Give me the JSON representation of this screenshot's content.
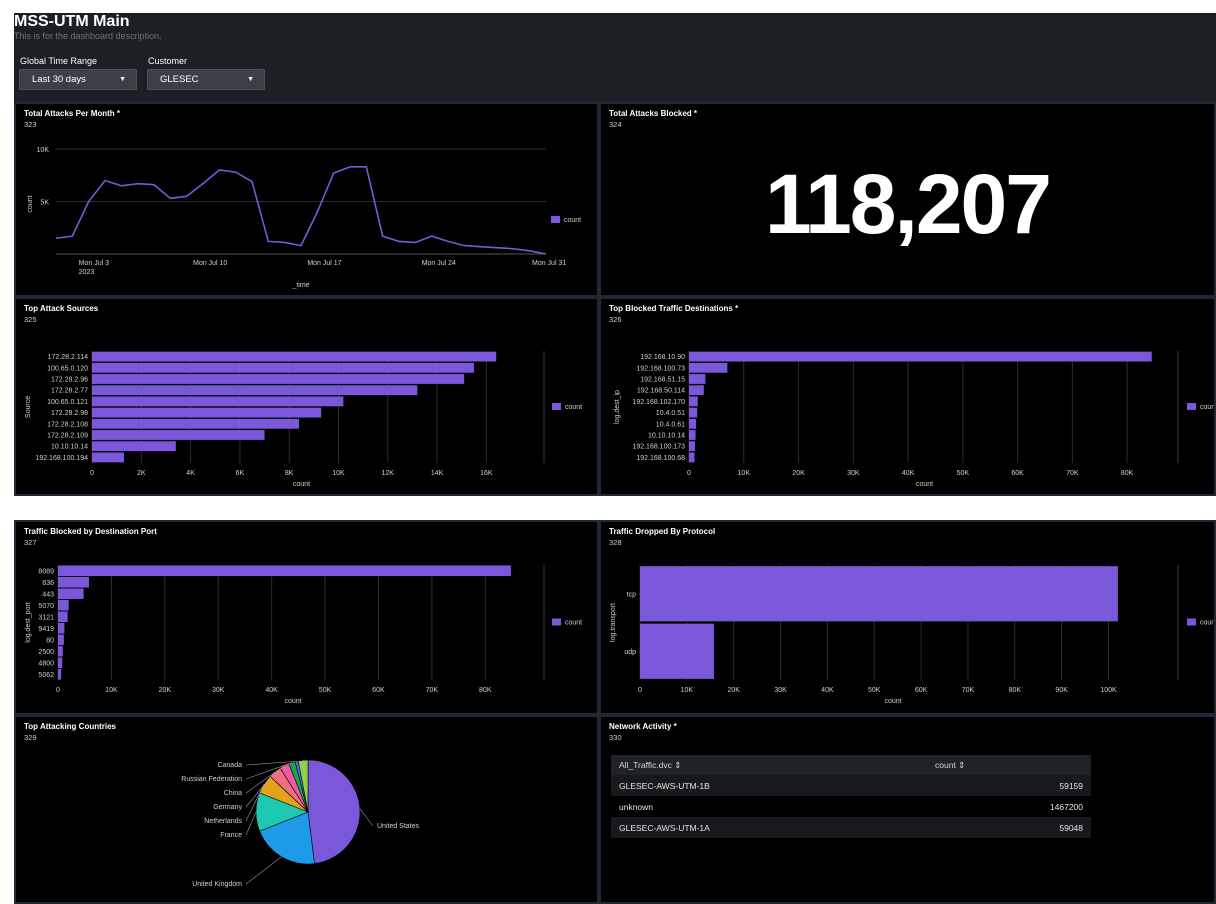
{
  "dashboard": {
    "title": "MSS-UTM Main",
    "description": "This is for the dashboard description.",
    "filters": [
      {
        "label": "Global Time Range",
        "value": "Last 30 days"
      },
      {
        "label": "Customer",
        "value": "GLESEC"
      }
    ]
  },
  "panels": {
    "attacks_month": {
      "title": "Total Attacks Per Month *",
      "id": "323"
    },
    "attacks_blocked": {
      "title": "Total Attacks Blocked *",
      "id": "324",
      "value": "118,207"
    },
    "attack_sources": {
      "title": "Top Attack Sources",
      "id": "325"
    },
    "blocked_dest": {
      "title": "Top Blocked Traffic Destinations *",
      "id": "326"
    },
    "dest_port": {
      "title": "Traffic Blocked by Destination Port",
      "id": "327"
    },
    "protocol": {
      "title": "Traffic Dropped By Protocol",
      "id": "328"
    },
    "countries": {
      "title": "Top Attacking Countries",
      "id": "329"
    },
    "network": {
      "title": "Network Activity *",
      "id": "330",
      "columns": [
        "All_Traffic.dvc ⇕",
        "count ⇕"
      ],
      "rows": [
        [
          "GLESEC-AWS-UTM-1B",
          "59159"
        ],
        [
          "unknown",
          "1467200"
        ],
        [
          "GLESEC-AWS-UTM-1A",
          "59048"
        ]
      ]
    }
  },
  "colors": {
    "series": "#7b57d9",
    "background": "#000000",
    "header": "#1c1f24"
  },
  "chart_data": [
    {
      "type": "line",
      "panel": "attacks_month",
      "xlabel": "_time",
      "ylabel": "count",
      "x_ticks": [
        "Mon Jul 3\n2023",
        "Mon Jul 10",
        "Mon Jul 17",
        "Mon Jul 24",
        "Mon Jul 31"
      ],
      "y_ticks": [
        "5K",
        "10K"
      ],
      "ylim": [
        0,
        10000
      ],
      "series": [
        {
          "name": "count",
          "x": [
            "2023-07-01",
            "2023-07-02",
            "2023-07-03",
            "2023-07-04",
            "2023-07-05",
            "2023-07-06",
            "2023-07-07",
            "2023-07-08",
            "2023-07-09",
            "2023-07-10",
            "2023-07-11",
            "2023-07-12",
            "2023-07-13",
            "2023-07-14",
            "2023-07-15",
            "2023-07-16",
            "2023-07-17",
            "2023-07-18",
            "2023-07-19",
            "2023-07-20",
            "2023-07-21",
            "2023-07-22",
            "2023-07-23",
            "2023-07-24",
            "2023-07-25",
            "2023-07-26",
            "2023-07-27",
            "2023-07-28",
            "2023-07-29",
            "2023-07-30",
            "2023-07-31"
          ],
          "values": [
            1500,
            1700,
            5000,
            7000,
            6500,
            6700,
            6600,
            5300,
            5500,
            6700,
            8000,
            7800,
            6900,
            1200,
            1100,
            800,
            4000,
            7700,
            8300,
            8300,
            1700,
            1200,
            1100,
            1700,
            1200,
            800,
            700,
            600,
            500,
            300,
            0
          ]
        }
      ],
      "legend": "right"
    },
    {
      "type": "bar",
      "orientation": "horizontal",
      "panel": "attack_sources",
      "xlabel": "count",
      "ylabel": "Source",
      "categories": [
        "172.28.2.114",
        "100.65.0.120",
        "172.28.2.96",
        "172.28.2.77",
        "100.65.0.121",
        "172.28.2.98",
        "172.28.2.108",
        "172.28.2.109",
        "10.10.10.14",
        "192.168.100.194"
      ],
      "x_ticks": [
        "0",
        "2K",
        "4K",
        "6K",
        "8K",
        "10K",
        "12K",
        "14K",
        "16K"
      ],
      "xlim": [
        0,
        17000
      ],
      "series": [
        {
          "name": "count",
          "values": [
            16400,
            15500,
            15100,
            13200,
            10200,
            9300,
            8400,
            7000,
            3400,
            1300
          ]
        }
      ],
      "legend": "right"
    },
    {
      "type": "bar",
      "orientation": "horizontal",
      "panel": "blocked_dest",
      "xlabel": "count",
      "ylabel": "log.dest_ip",
      "categories": [
        "192.168.10.90",
        "192.168.100.73",
        "192.168.51.15",
        "192.168.50.114",
        "192.168.102.170",
        "10.4.0.51",
        "10.4.0.61",
        "10.10.10.14",
        "192.168.100.173",
        "192.168.100.68"
      ],
      "x_ticks": [
        "0",
        "10K",
        "20K",
        "30K",
        "40K",
        "50K",
        "60K",
        "70K",
        "80K"
      ],
      "xlim": [
        0,
        86000
      ],
      "series": [
        {
          "name": "count",
          "values": [
            84500,
            7000,
            3000,
            2700,
            1600,
            1500,
            1300,
            1200,
            1100,
            1000
          ]
        }
      ],
      "legend": "right"
    },
    {
      "type": "bar",
      "orientation": "horizontal",
      "panel": "dest_port",
      "xlabel": "count",
      "ylabel": "log.dest_port",
      "categories": [
        "8089",
        "636",
        "443",
        "5070",
        "3121",
        "9419",
        "80",
        "2500",
        "4800",
        "5062"
      ],
      "x_ticks": [
        "0",
        "10K",
        "20K",
        "30K",
        "40K",
        "50K",
        "60K",
        "70K",
        "80K"
      ],
      "xlim": [
        0,
        88000
      ],
      "series": [
        {
          "name": "count",
          "values": [
            84800,
            5800,
            4800,
            2000,
            1800,
            1200,
            1100,
            900,
            800,
            600
          ]
        }
      ],
      "legend": "right"
    },
    {
      "type": "bar",
      "orientation": "horizontal",
      "panel": "protocol",
      "xlabel": "count",
      "ylabel": "log.transport",
      "categories": [
        "tcp",
        "udp"
      ],
      "x_ticks": [
        "0",
        "10K",
        "20K",
        "30K",
        "40K",
        "50K",
        "60K",
        "70K",
        "80K",
        "90K",
        "100K"
      ],
      "xlim": [
        0,
        108000
      ],
      "series": [
        {
          "name": "count",
          "values": [
            102000,
            15800
          ]
        }
      ],
      "legend": "right"
    },
    {
      "type": "pie",
      "panel": "countries",
      "slices": [
        {
          "label": "United States",
          "value": 48,
          "color": "#7b57d9"
        },
        {
          "label": "United Kingdom",
          "value": 21,
          "color": "#1e9be8"
        },
        {
          "label": "France",
          "value": 12,
          "color": "#1ec8b0"
        },
        {
          "label": "Netherlands",
          "value": 6,
          "color": "#e3a21a"
        },
        {
          "label": "Germany",
          "value": 4,
          "color": "#f26d7d"
        },
        {
          "label": "China",
          "value": 3,
          "color": "#ee5aa9"
        },
        {
          "label": "Russian Federation",
          "value": 2,
          "color": "#1aa64a"
        },
        {
          "label": "Canada",
          "value": 1,
          "color": "#3d7ad6"
        },
        {
          "label": "",
          "value": 3,
          "color": "#8fd14f"
        }
      ]
    }
  ]
}
